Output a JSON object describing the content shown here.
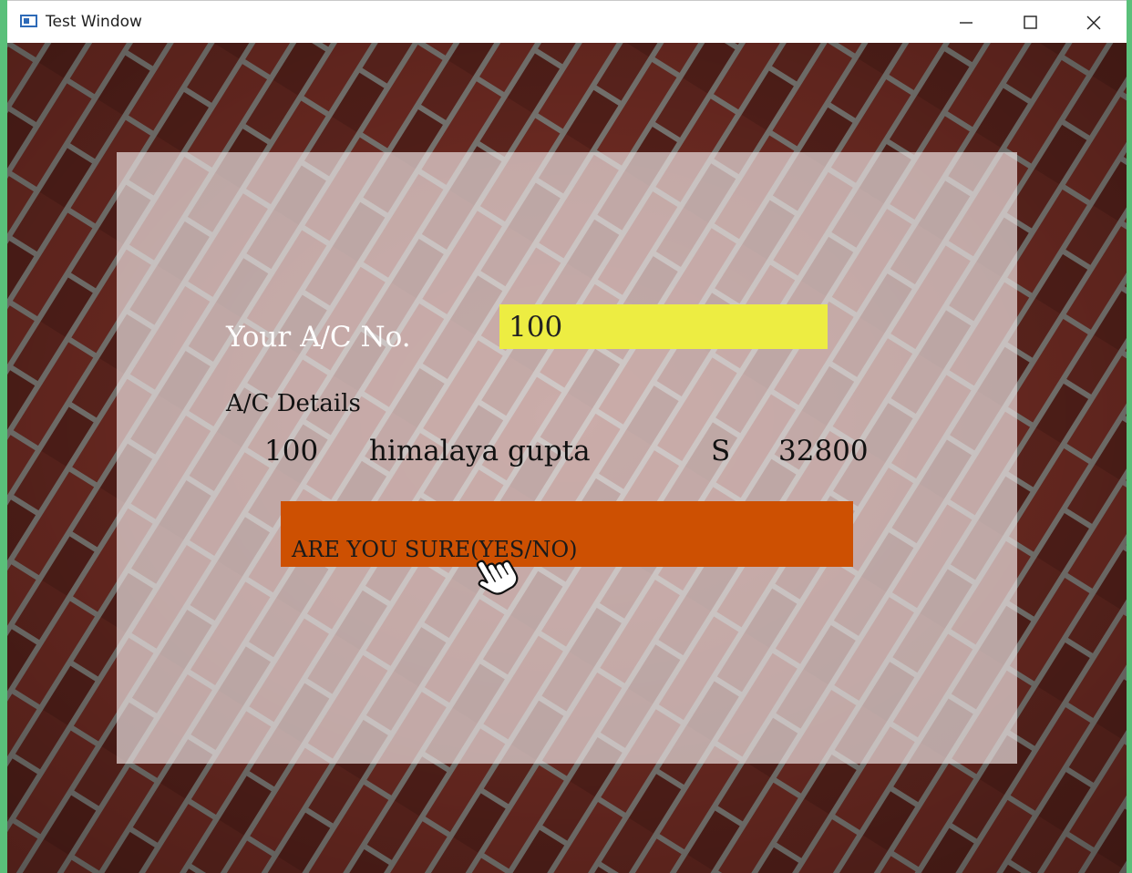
{
  "window": {
    "title": "Test Window",
    "icon": "app-window-icon",
    "controls": [
      "minimize-icon",
      "maximize-icon",
      "close-icon"
    ]
  },
  "form": {
    "acno_label": "Your A/C No.",
    "acno_value": "100",
    "details_label": "A/C Details",
    "details": {
      "acno": "100",
      "name": "himalaya gupta",
      "type": "S",
      "balance": "32800"
    },
    "confirm_label": "ARE YOU SURE(YES/NO)"
  },
  "colors": {
    "input_background": "#eded42",
    "confirm_background": "#cd5002",
    "window_accent": "#5ac07a",
    "brick": "#7a2f26",
    "mortar": "#8a8782"
  },
  "cursor": "hand-pointer-icon"
}
